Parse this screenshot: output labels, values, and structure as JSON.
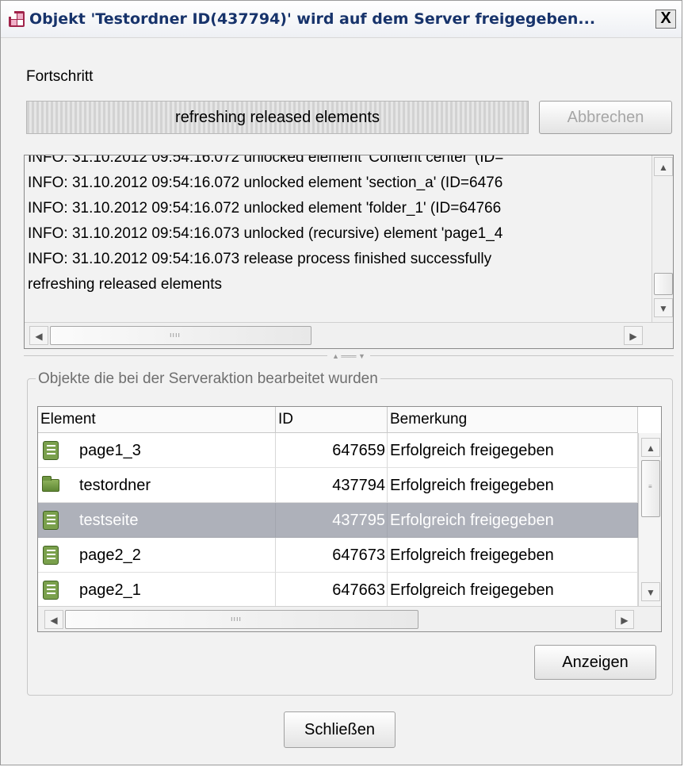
{
  "window": {
    "title": "Objekt 'Testordner ID(437794)' wird auf dem Server freigegeben...",
    "close_label": "X"
  },
  "progress": {
    "label": "Fortschritt",
    "status_text": "refreshing released elements",
    "cancel_label": "Abbrechen"
  },
  "log": {
    "lines": [
      "INFO:  31.10.2012 09:54:16.072 unlocked element 'Content center' (ID=",
      "INFO:  31.10.2012 09:54:16.072 unlocked element 'section_a' (ID=6476",
      "INFO:  31.10.2012 09:54:16.072 unlocked element 'folder_1' (ID=64766",
      "INFO:  31.10.2012 09:54:16.073 unlocked (recursive) element 'page1_4",
      "INFO:  31.10.2012 09:54:16.073 release process finished successfully",
      "refreshing released elements"
    ]
  },
  "objects": {
    "group_title": "Objekte die bei der Serveraktion bearbeitet wurden",
    "columns": [
      "Element",
      "ID",
      "Bemerkung"
    ],
    "rows": [
      {
        "icon": "page-icon",
        "name": "page1_3",
        "id": "647659",
        "remark": "Erfolgreich freigegeben"
      },
      {
        "icon": "folder-icon",
        "name": "testordner",
        "id": "437794",
        "remark": "Erfolgreich freigegeben"
      },
      {
        "icon": "page-icon",
        "name": "testseite",
        "id": "437795",
        "remark": "Erfolgreich freigegeben",
        "selected": true
      },
      {
        "icon": "page-icon",
        "name": "page2_2",
        "id": "647673",
        "remark": "Erfolgreich freigegeben"
      },
      {
        "icon": "page-icon",
        "name": "page2_1",
        "id": "647663",
        "remark": "Erfolgreich freigegeben"
      }
    ],
    "show_label": "Anzeigen"
  },
  "footer": {
    "close_label": "Schließen"
  },
  "colors": {
    "title_text": "#17336b",
    "selection": "#aeb1ba",
    "icon_green": "#7aa04c"
  }
}
